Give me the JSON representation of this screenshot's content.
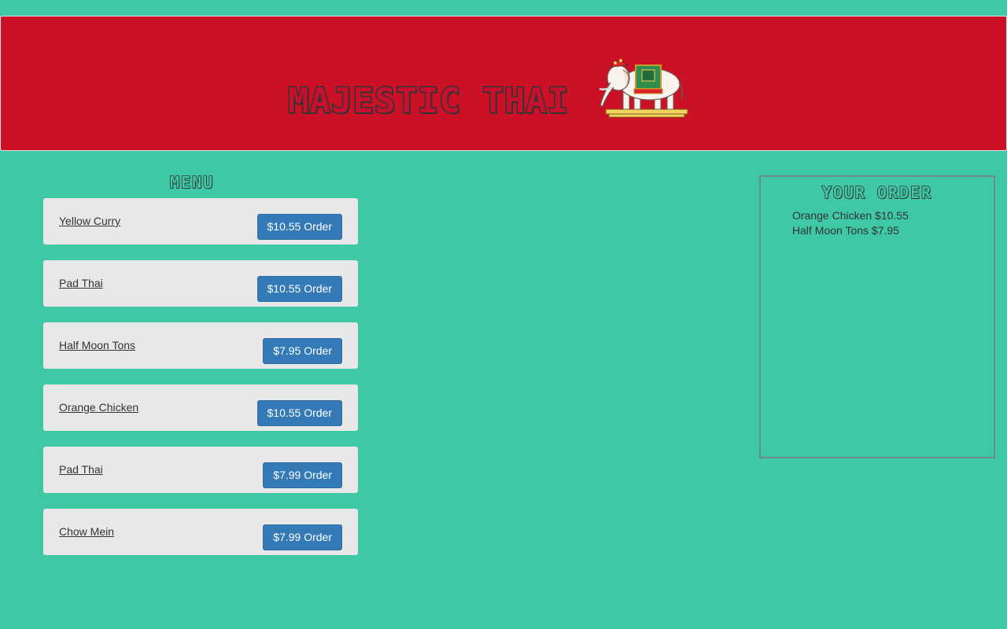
{
  "header": {
    "title": "MAJESTIC THAI",
    "logo_icon": "elephant-icon"
  },
  "menu": {
    "heading": "MENU",
    "items": [
      {
        "name": "Yellow Curry",
        "button": "$10.55 Order"
      },
      {
        "name": "Pad Thai",
        "button": "$10.55 Order"
      },
      {
        "name": "Half Moon Tons",
        "button": "$7.95 Order"
      },
      {
        "name": "Orange Chicken",
        "button": "$10.55 Order"
      },
      {
        "name": "Pad Thai",
        "button": "$7.99 Order"
      },
      {
        "name": "Chow Mein",
        "button": "$7.99 Order"
      }
    ]
  },
  "order": {
    "heading": "YOUR ORDER",
    "lines": [
      "Orange Chicken $10.55",
      "Half Moon Tons $7.95"
    ]
  },
  "colors": {
    "background": "#3ec8a6",
    "header": "#cc1126",
    "button": "#337ab7",
    "menu_item": "#e8e8e8"
  }
}
